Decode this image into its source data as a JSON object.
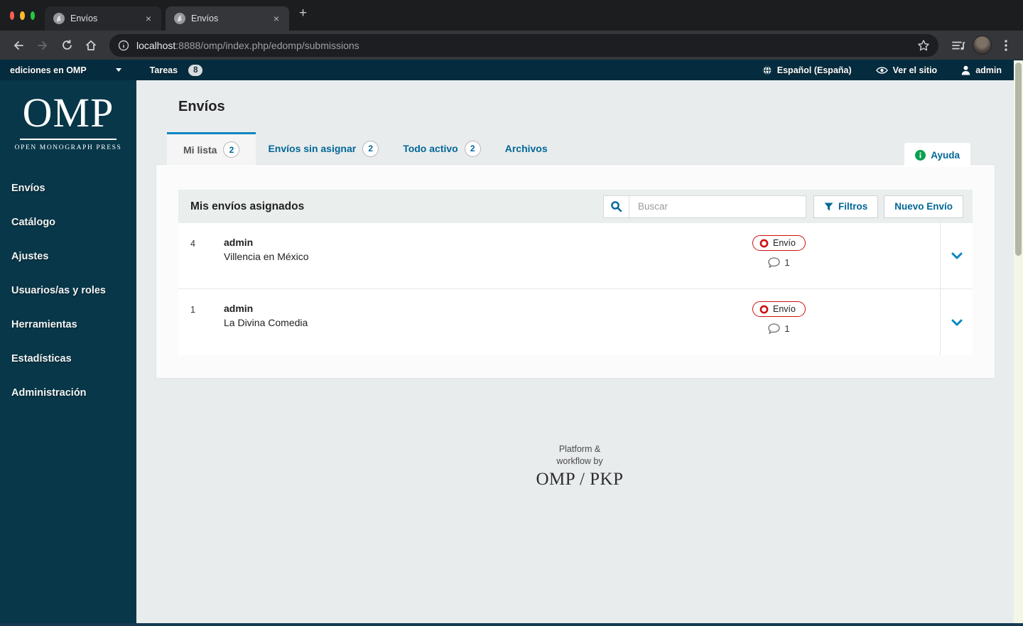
{
  "browser": {
    "tabs": [
      {
        "title": "Envíos"
      },
      {
        "title": "Envíos"
      }
    ],
    "new_tab_glyph": "+",
    "close_glyph": "×",
    "url_host": "localhost",
    "url_rest": ":8888/omp/index.php/edomp/submissions"
  },
  "topbar": {
    "press_name": "ediciones en OMP",
    "tasks_label": "Tareas",
    "tasks_count": "8",
    "language": "Español (España)",
    "view_site": "Ver el sitio",
    "user": "admin"
  },
  "sidebar": {
    "logo_acronym": "OMP",
    "logo_subtitle": "OPEN MONOGRAPH PRESS",
    "items": [
      {
        "label": "Envíos"
      },
      {
        "label": "Catálogo"
      },
      {
        "label": "Ajustes"
      },
      {
        "label": "Usuarios/as y roles"
      },
      {
        "label": "Herramientas"
      },
      {
        "label": "Estadísticas"
      },
      {
        "label": "Administración"
      }
    ]
  },
  "main": {
    "page_title": "Envíos",
    "tabs": [
      {
        "label": "Mi lista",
        "count": "2"
      },
      {
        "label": "Envíos sin asignar",
        "count": "2"
      },
      {
        "label": "Todo activo",
        "count": "2"
      },
      {
        "label": "Archivos"
      }
    ],
    "help_label": "Ayuda",
    "panel": {
      "title": "Mis envíos asignados",
      "search_placeholder": "Buscar",
      "filters_label": "Filtros",
      "new_submission_label": "Nuevo Envío",
      "rows": [
        {
          "id": "4",
          "author": "admin",
          "title": "Villencia en México",
          "stage": "Envío",
          "comments": "1"
        },
        {
          "id": "1",
          "author": "admin",
          "title": "La Divina Comedia",
          "stage": "Envío",
          "comments": "1"
        }
      ]
    },
    "footer": {
      "line1": "Platform &",
      "line2": "workflow by",
      "brand": "OMP / PKP"
    }
  },
  "colors": {
    "accent_blue": "#006798",
    "tab_highlight": "#0b87c0",
    "stage_red": "#cf1010",
    "help_green": "#0aa04f",
    "topbar_bg": "#052c3e",
    "sidebar_bg": "#073749"
  },
  "icons": {
    "search": "magnifier",
    "filter": "funnel",
    "stage": "red-ring",
    "comments": "speech-bubble",
    "expand": "chevron-down",
    "help": "info-circle"
  }
}
